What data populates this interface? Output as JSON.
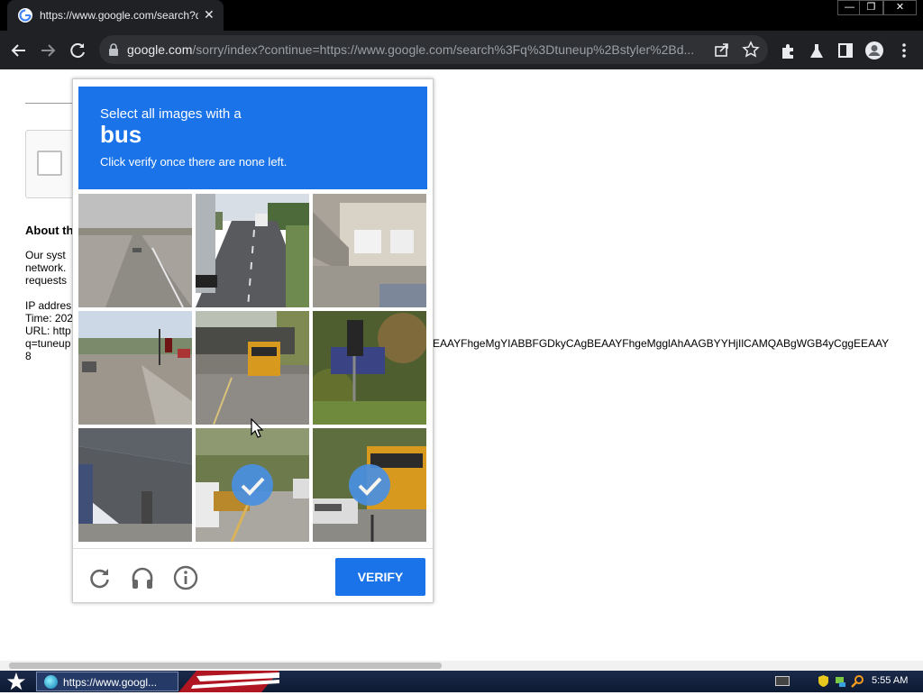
{
  "browser": {
    "tab_title": "https://www.google.com/search?q=",
    "tab_close": "✕",
    "url_host": "google.com",
    "url_rest": "/sorry/index?continue=https://www.google.com/search%3Fq%3Dtuneup%2Bstyler%2Bd...",
    "window_buttons": {
      "minimize": "—",
      "restore": "❐",
      "close": "✕"
    }
  },
  "page": {
    "about_heading": "About th",
    "para1_line1": "Our syst",
    "para1_line2": "network.",
    "para1_line3": "requests",
    "ip_line": "IP addres",
    "time_line": "Time: 202",
    "url_line": "URL: http",
    "q_line": "q=tuneup",
    "eight_line": "8",
    "long_url_fragment": "EAAYFhgeMgYIABBFGDkyCAgBEAAYFhgeMgglAhAAGBYYHjIlCAMQABgWGB4yCggEEAAY"
  },
  "challenge": {
    "instruction_line1": "Select all images with a",
    "target_object": "bus",
    "instruction_line3": "Click verify once there are none left.",
    "tiles_selected": [
      false,
      false,
      false,
      false,
      false,
      false,
      false,
      true,
      true
    ],
    "verify_label": "VERIFY",
    "colors": {
      "accent": "#1a73e8",
      "check": "#4a90e2"
    }
  },
  "icons": [
    "back-icon",
    "forward-icon",
    "reload-icon",
    "lock-icon",
    "share-icon",
    "star-icon",
    "extensions-icon",
    "labs-icon",
    "sidepanel-icon",
    "profile-icon",
    "menu-icon",
    "refresh-challenge-icon",
    "audio-challenge-icon",
    "info-icon"
  ],
  "taskbar": {
    "task_label": "https://www.googl...",
    "clock": "5:55 AM"
  }
}
